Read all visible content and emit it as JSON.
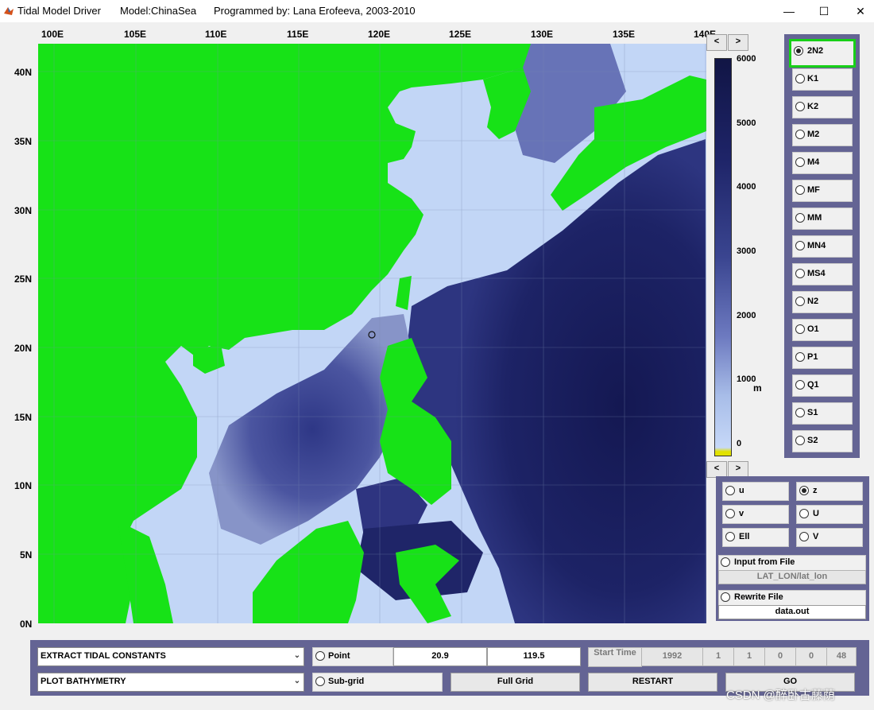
{
  "window": {
    "app_title": "Tidal Model Driver",
    "model": "Model:ChinaSea",
    "author": "Programmed by: Lana Erofeeva, 2003-2010",
    "minimize": "—",
    "maximize": "☐",
    "close": "✕"
  },
  "map": {
    "x_ticks": [
      "100E",
      "105E",
      "110E",
      "115E",
      "120E",
      "125E",
      "130E",
      "135E",
      "140E"
    ],
    "y_ticks": [
      "40N",
      "35N",
      "30N",
      "25N",
      "20N",
      "15N",
      "10N",
      "5N",
      "0N"
    ],
    "land_color": "#17e217",
    "shallow_color": "#c2d6f6",
    "deep_color": "#161a5a",
    "marker": "o"
  },
  "colorbar": {
    "ticks": [
      "6000",
      "5000",
      "4000",
      "3000",
      "2000",
      "1000",
      "0"
    ],
    "unit": "m",
    "prev": "<",
    "next": ">"
  },
  "constituents": {
    "selected": "2N2",
    "items": [
      "2N2",
      "K1",
      "K2",
      "M2",
      "M4",
      "MF",
      "MM",
      "MN4",
      "MS4",
      "N2",
      "O1",
      "P1",
      "Q1",
      "S1",
      "S2"
    ]
  },
  "nav2": {
    "prev": "<",
    "next": ">"
  },
  "variables": {
    "selected": "z",
    "items": [
      [
        "u",
        "z"
      ],
      [
        "v",
        "U"
      ],
      [
        "Ell",
        "V"
      ]
    ]
  },
  "file": {
    "input_label": "Input from File",
    "input_value": "LAT_LON/lat_lon",
    "rewrite_label": "Rewrite File",
    "rewrite_value": "data.out"
  },
  "controls": {
    "mode_select": "EXTRACT TIDAL CONSTANTS",
    "plot_select": "PLOT BATHYMETRY",
    "point_label": "Point",
    "lat": "20.9",
    "lon": "119.5",
    "subgrid_label": "Sub-grid",
    "full_grid": "Full Grid",
    "start_time": "Start Time",
    "time_fields": [
      "1992",
      "1",
      "1",
      "0",
      "0",
      "48"
    ],
    "restart": "RESTART",
    "go": "GO"
  },
  "watermark": "CSDN @醉卧古藤荫"
}
